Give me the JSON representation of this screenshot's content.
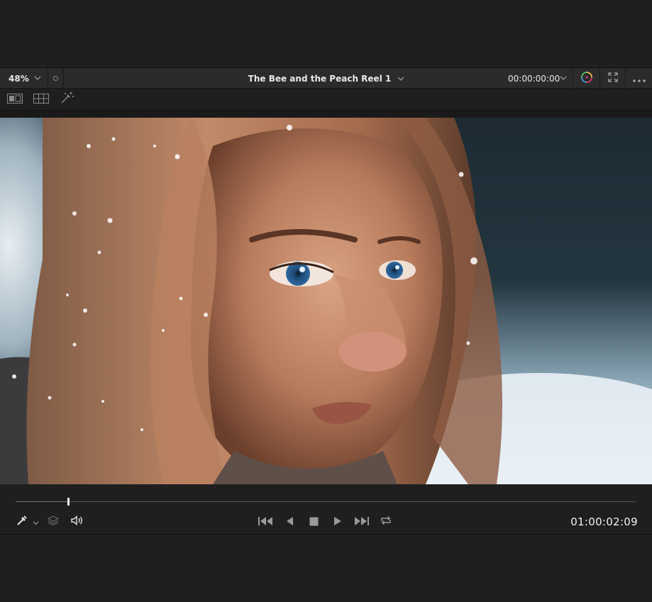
{
  "viewer": {
    "zoom_label": "48%",
    "clip_title": "The Bee and the Peach Reel 1",
    "source_timecode": "00:00:00:00"
  },
  "icons": {
    "header": [
      "chevron-down-icon",
      "dot-icon",
      "color-wheel-icon",
      "expand-icon",
      "more-icon"
    ],
    "toolstrip": [
      "single-viewer-icon",
      "grid-viewer-icon",
      "magic-wand-icon"
    ],
    "transport": [
      "eyedropper-icon",
      "layers-icon",
      "speaker-icon",
      "skip-to-start-icon",
      "step-back-icon",
      "stop-icon",
      "play-icon",
      "skip-to-end-icon",
      "loop-icon"
    ]
  },
  "playback": {
    "timecode": "01:00:02:09",
    "position_fraction": 0.085
  },
  "colors": {
    "panel": "#2b2b2b",
    "background": "#1f1f1f",
    "accent_color_wheel": [
      "#e9c24a",
      "#d9386c",
      "#4a9be0",
      "#57c46b"
    ]
  }
}
